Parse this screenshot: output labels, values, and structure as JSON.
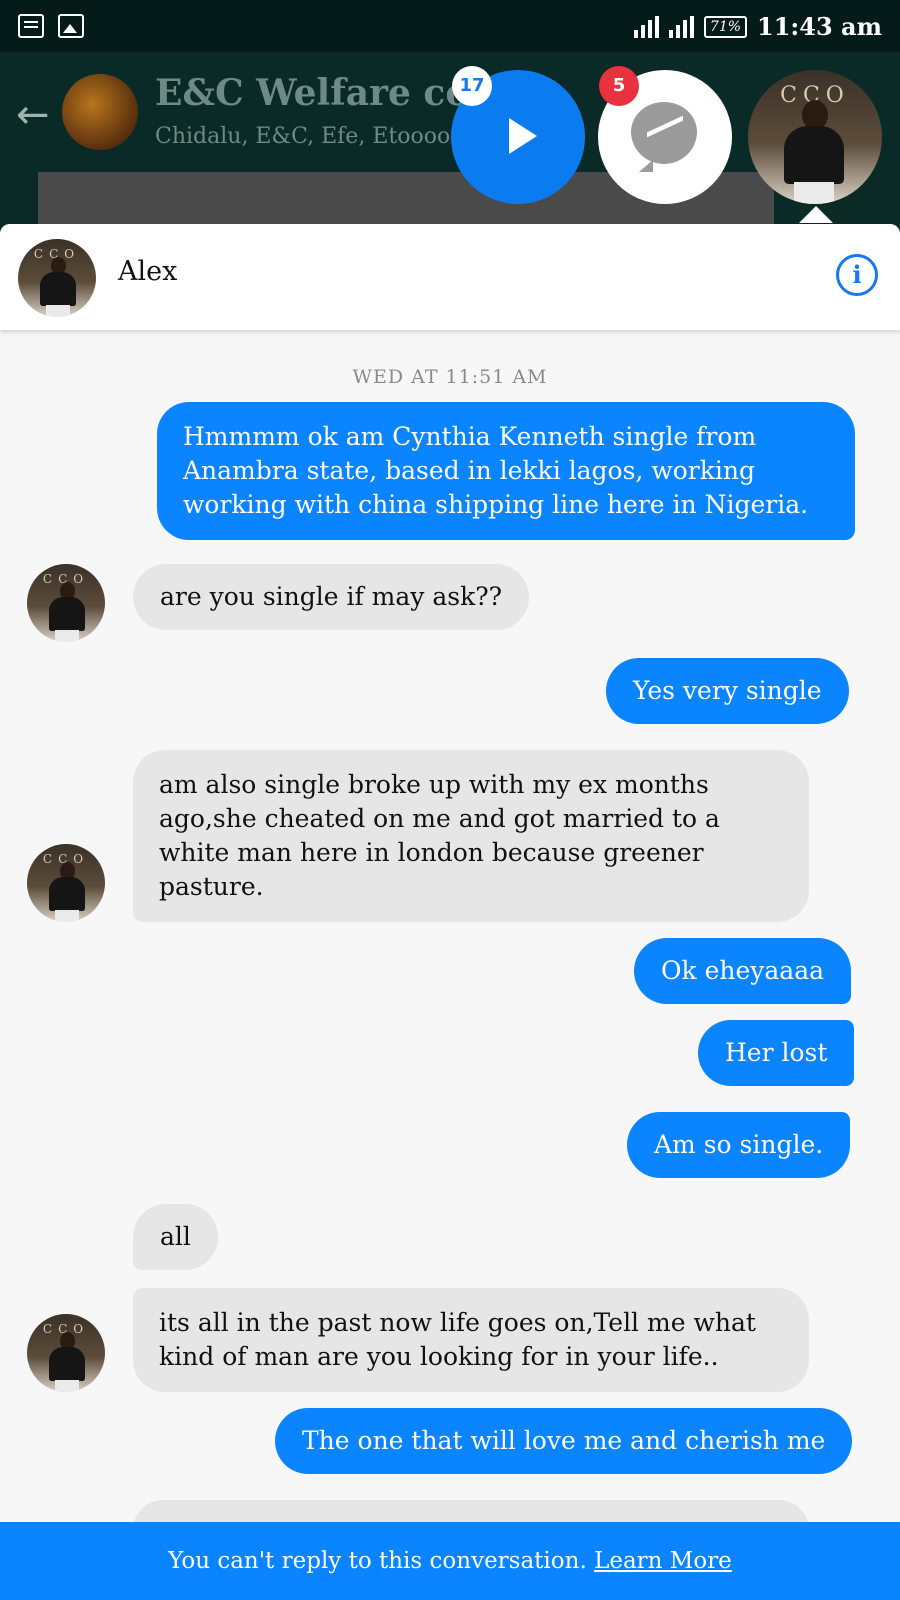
{
  "status_bar": {
    "icons": [
      "message-icon",
      "image-icon"
    ],
    "battery": "71%",
    "time": "11:43 am"
  },
  "background_chat": {
    "title": "E&C Welfare com",
    "subtitle": "Chidalu, E&C, Efe, Etoooo"
  },
  "chat_heads": {
    "video_badge": "17",
    "messenger_badge": "5"
  },
  "conversation": {
    "contact_name": "Alex",
    "timestamp": "WED AT 11:51 AM",
    "messages": [
      {
        "from": "me",
        "text": "Hmmmm ok am Cynthia Kenneth single from Anambra state, based in lekki lagos,  working working with china shipping line here in Nigeria."
      },
      {
        "from": "them",
        "text": "are you single if may ask??"
      },
      {
        "from": "me",
        "text": "Yes very single"
      },
      {
        "from": "them",
        "text": "am also single broke up with my ex months ago,she cheated on me and got married to a white man here in london because greener pasture."
      },
      {
        "from": "me",
        "text": "Ok eheyaaaa"
      },
      {
        "from": "me",
        "text": "Her lost"
      },
      {
        "from": "me",
        "text": "Am so single."
      },
      {
        "from": "them",
        "text": "all"
      },
      {
        "from": "them",
        "text": "its all in the past now life goes on,Tell me what kind of man are you looking for in your life.."
      },
      {
        "from": "me",
        "text": "The one that will love me and cherish me"
      }
    ]
  },
  "footer": {
    "notice": "You can't reply to this conversation.",
    "link": "Learn More"
  },
  "colors": {
    "accent": "#0a84ff",
    "incoming_bubble": "#e6e6e6",
    "badge_red": "#e8323d"
  }
}
